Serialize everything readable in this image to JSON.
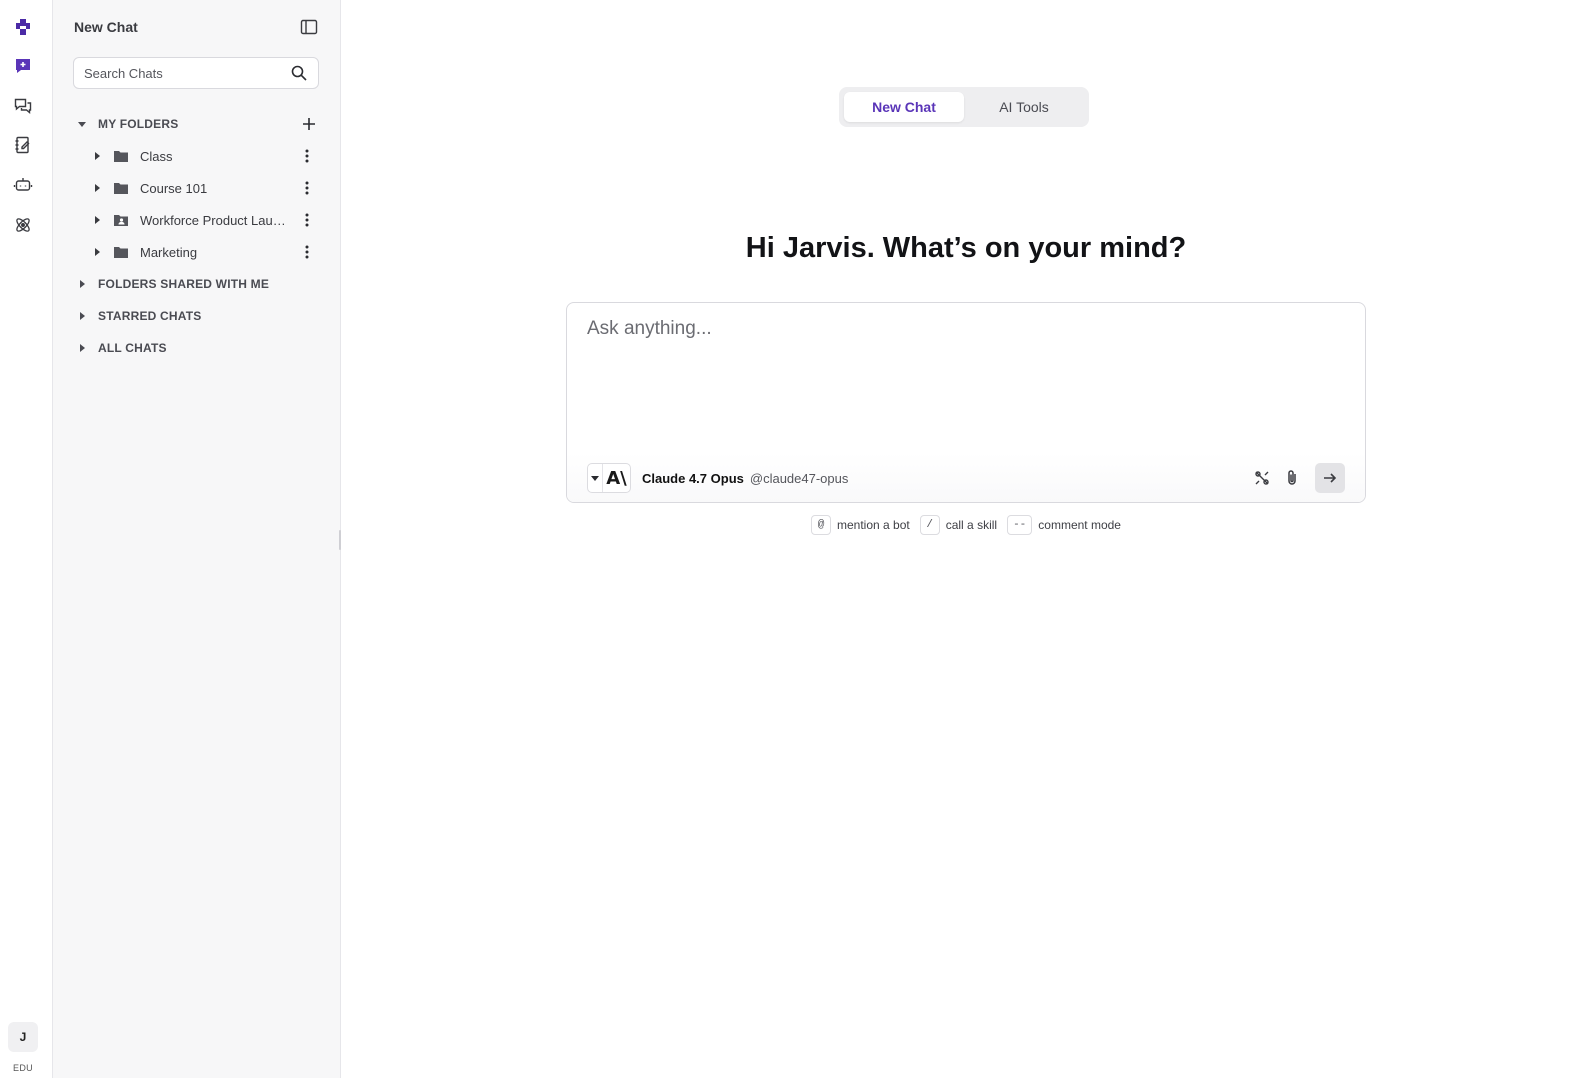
{
  "rail": {
    "items": [
      {
        "icon": "app-logo-icon"
      },
      {
        "icon": "new-chat-icon"
      },
      {
        "icon": "chats-icon"
      },
      {
        "icon": "notebook-icon"
      },
      {
        "icon": "bot-icon"
      },
      {
        "icon": "atom-icon"
      }
    ],
    "avatar_initial": "J",
    "plan_label": "EDU"
  },
  "sidebar": {
    "title": "New Chat",
    "search_placeholder": "Search Chats",
    "my_folders": {
      "label": "MY FOLDERS",
      "folders": [
        {
          "label": "Class",
          "icon": "folder-icon"
        },
        {
          "label": "Course 101",
          "icon": "folder-icon"
        },
        {
          "label": "Workforce Product Launch",
          "icon": "shared-folder-icon"
        },
        {
          "label": "Marketing",
          "icon": "folder-icon"
        }
      ]
    },
    "sections": [
      {
        "label": "FOLDERS SHARED WITH ME"
      },
      {
        "label": "STARRED CHATS"
      },
      {
        "label": "ALL CHATS"
      }
    ]
  },
  "main": {
    "tabs": [
      {
        "label": "New Chat",
        "active": true
      },
      {
        "label": "AI Tools",
        "active": false
      }
    ],
    "greeting": "Hi Jarvis. What’s on your mind?",
    "composer": {
      "placeholder": "Ask anything...",
      "value": "",
      "bot_name": "Claude 4.7 Opus",
      "bot_handle": "@claude47-opus",
      "bot_logo_text": "A\\"
    },
    "hints": [
      {
        "key": "@",
        "label": "mention a bot"
      },
      {
        "key": "/",
        "label": "call a skill"
      },
      {
        "key": "--",
        "label": "comment mode"
      }
    ]
  },
  "colors": {
    "accent": "#5a35b8",
    "sidebar_bg": "#f7f7f8",
    "border": "#d9d9de"
  }
}
